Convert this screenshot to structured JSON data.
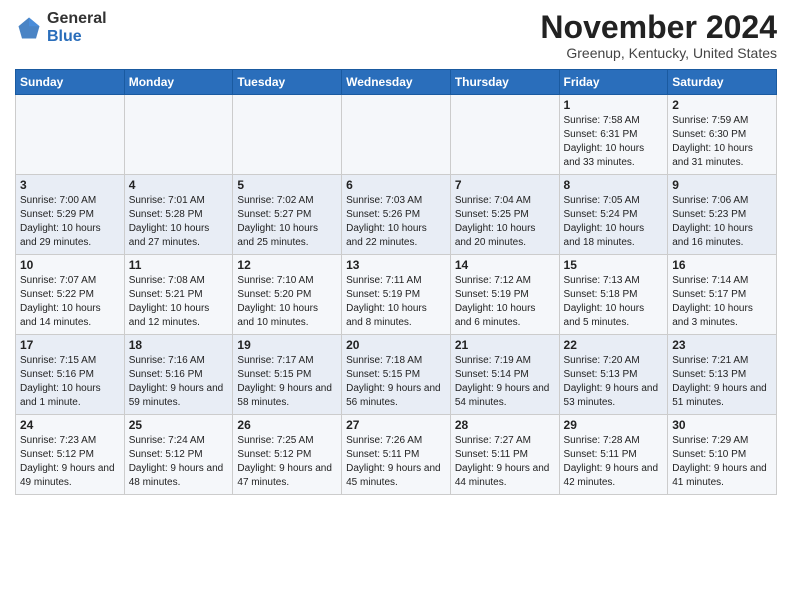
{
  "header": {
    "logo_line1": "General",
    "logo_line2": "Blue",
    "month": "November 2024",
    "location": "Greenup, Kentucky, United States"
  },
  "weekdays": [
    "Sunday",
    "Monday",
    "Tuesday",
    "Wednesday",
    "Thursday",
    "Friday",
    "Saturday"
  ],
  "weeks": [
    [
      {
        "day": "",
        "info": ""
      },
      {
        "day": "",
        "info": ""
      },
      {
        "day": "",
        "info": ""
      },
      {
        "day": "",
        "info": ""
      },
      {
        "day": "",
        "info": ""
      },
      {
        "day": "1",
        "info": "Sunrise: 7:58 AM\nSunset: 6:31 PM\nDaylight: 10 hours and 33 minutes."
      },
      {
        "day": "2",
        "info": "Sunrise: 7:59 AM\nSunset: 6:30 PM\nDaylight: 10 hours and 31 minutes."
      }
    ],
    [
      {
        "day": "3",
        "info": "Sunrise: 7:00 AM\nSunset: 5:29 PM\nDaylight: 10 hours and 29 minutes."
      },
      {
        "day": "4",
        "info": "Sunrise: 7:01 AM\nSunset: 5:28 PM\nDaylight: 10 hours and 27 minutes."
      },
      {
        "day": "5",
        "info": "Sunrise: 7:02 AM\nSunset: 5:27 PM\nDaylight: 10 hours and 25 minutes."
      },
      {
        "day": "6",
        "info": "Sunrise: 7:03 AM\nSunset: 5:26 PM\nDaylight: 10 hours and 22 minutes."
      },
      {
        "day": "7",
        "info": "Sunrise: 7:04 AM\nSunset: 5:25 PM\nDaylight: 10 hours and 20 minutes."
      },
      {
        "day": "8",
        "info": "Sunrise: 7:05 AM\nSunset: 5:24 PM\nDaylight: 10 hours and 18 minutes."
      },
      {
        "day": "9",
        "info": "Sunrise: 7:06 AM\nSunset: 5:23 PM\nDaylight: 10 hours and 16 minutes."
      }
    ],
    [
      {
        "day": "10",
        "info": "Sunrise: 7:07 AM\nSunset: 5:22 PM\nDaylight: 10 hours and 14 minutes."
      },
      {
        "day": "11",
        "info": "Sunrise: 7:08 AM\nSunset: 5:21 PM\nDaylight: 10 hours and 12 minutes."
      },
      {
        "day": "12",
        "info": "Sunrise: 7:10 AM\nSunset: 5:20 PM\nDaylight: 10 hours and 10 minutes."
      },
      {
        "day": "13",
        "info": "Sunrise: 7:11 AM\nSunset: 5:19 PM\nDaylight: 10 hours and 8 minutes."
      },
      {
        "day": "14",
        "info": "Sunrise: 7:12 AM\nSunset: 5:19 PM\nDaylight: 10 hours and 6 minutes."
      },
      {
        "day": "15",
        "info": "Sunrise: 7:13 AM\nSunset: 5:18 PM\nDaylight: 10 hours and 5 minutes."
      },
      {
        "day": "16",
        "info": "Sunrise: 7:14 AM\nSunset: 5:17 PM\nDaylight: 10 hours and 3 minutes."
      }
    ],
    [
      {
        "day": "17",
        "info": "Sunrise: 7:15 AM\nSunset: 5:16 PM\nDaylight: 10 hours and 1 minute."
      },
      {
        "day": "18",
        "info": "Sunrise: 7:16 AM\nSunset: 5:16 PM\nDaylight: 9 hours and 59 minutes."
      },
      {
        "day": "19",
        "info": "Sunrise: 7:17 AM\nSunset: 5:15 PM\nDaylight: 9 hours and 58 minutes."
      },
      {
        "day": "20",
        "info": "Sunrise: 7:18 AM\nSunset: 5:15 PM\nDaylight: 9 hours and 56 minutes."
      },
      {
        "day": "21",
        "info": "Sunrise: 7:19 AM\nSunset: 5:14 PM\nDaylight: 9 hours and 54 minutes."
      },
      {
        "day": "22",
        "info": "Sunrise: 7:20 AM\nSunset: 5:13 PM\nDaylight: 9 hours and 53 minutes."
      },
      {
        "day": "23",
        "info": "Sunrise: 7:21 AM\nSunset: 5:13 PM\nDaylight: 9 hours and 51 minutes."
      }
    ],
    [
      {
        "day": "24",
        "info": "Sunrise: 7:23 AM\nSunset: 5:12 PM\nDaylight: 9 hours and 49 minutes."
      },
      {
        "day": "25",
        "info": "Sunrise: 7:24 AM\nSunset: 5:12 PM\nDaylight: 9 hours and 48 minutes."
      },
      {
        "day": "26",
        "info": "Sunrise: 7:25 AM\nSunset: 5:12 PM\nDaylight: 9 hours and 47 minutes."
      },
      {
        "day": "27",
        "info": "Sunrise: 7:26 AM\nSunset: 5:11 PM\nDaylight: 9 hours and 45 minutes."
      },
      {
        "day": "28",
        "info": "Sunrise: 7:27 AM\nSunset: 5:11 PM\nDaylight: 9 hours and 44 minutes."
      },
      {
        "day": "29",
        "info": "Sunrise: 7:28 AM\nSunset: 5:11 PM\nDaylight: 9 hours and 42 minutes."
      },
      {
        "day": "30",
        "info": "Sunrise: 7:29 AM\nSunset: 5:10 PM\nDaylight: 9 hours and 41 minutes."
      }
    ]
  ]
}
